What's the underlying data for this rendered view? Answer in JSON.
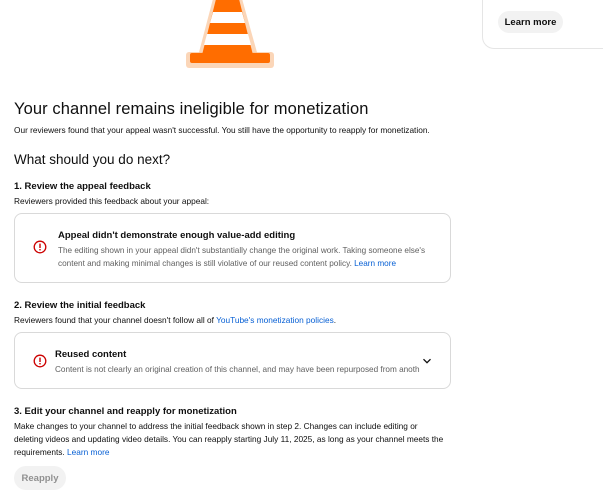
{
  "side_card": {
    "learn_more_label": "Learn more"
  },
  "header": {
    "title": "Your channel remains ineligible for monetization",
    "subtitle": "Our reviewers found that your appeal wasn't successful. You still have the opportunity to reapply for monetization."
  },
  "next_steps": {
    "heading": "What should you do next?"
  },
  "step1": {
    "title": "1. Review the appeal feedback",
    "description": "Reviewers provided this feedback about your appeal:",
    "card": {
      "title": "Appeal didn't demonstrate enough value-add editing",
      "body": "The editing shown in your appeal didn't substantially change the original work. Taking someone else's content and making minimal changes is still violative of our reused content policy. ",
      "link": "Learn more"
    }
  },
  "step2": {
    "title": "2. Review the initial feedback",
    "description_prefix": "Reviewers found that your channel doesn't follow all of ",
    "description_link": "YouTube's monetization policies",
    "description_suffix": ".",
    "card": {
      "title": "Reused content",
      "body": "Content is not clearly an original creation of this channel, and may have been repurposed from anoth"
    }
  },
  "step3": {
    "title": "3. Edit your channel and reapply for monetization",
    "description": "Make changes to your channel to address the initial feedback shown in step 2. Changes can include editing or deleting videos and updating video details. You can reapply starting July 11, 2025, as long as your channel meets the requirements. ",
    "link": "Learn more"
  },
  "reapply_button": "Reapply",
  "icons": {
    "cone": "traffic-cone-icon",
    "warning": "error-circle-icon",
    "chevron": "chevron-down-icon"
  },
  "colors": {
    "link": "#065fd4",
    "warning": "#cc0000",
    "cone_orange": "#ff6d00",
    "cone_outline": "#f9c49a"
  }
}
